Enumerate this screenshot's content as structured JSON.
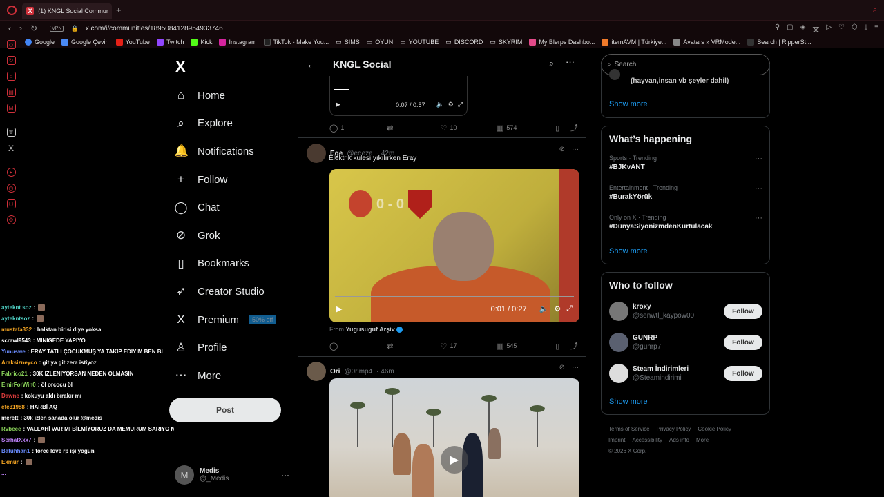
{
  "browser": {
    "tab_title": "(1) KNGL Social Communit",
    "url": "x.com/i/communities/1895084128954933746",
    "vpn": "VPN",
    "bookmarks": [
      "Google",
      "Google Çeviri",
      "YouTube",
      "Twitch",
      "Kick",
      "Instagram",
      "TikTok - Make You...",
      "SIMS",
      "OYUN",
      "YOUTUBE",
      "DISCORD",
      "SKYRIM",
      "My Blerps Dashbo...",
      "itemAVM | Türkiye...",
      "Avatars » VRMode...",
      "Search | RipperSt..."
    ]
  },
  "chat": [
    {
      "user": "ayteknt soz",
      "msg": ":",
      "color": "#4fd1c5"
    },
    {
      "user": "aytekntsoz",
      "msg": ":",
      "color": "#4fd1c5"
    },
    {
      "user": "mustafa332",
      "msg": ": halktan birisi diye yoksa",
      "color": "#f6a623"
    },
    {
      "user": "scrawl9543",
      "msg": ": MİNİGEDE YAPIYO",
      "color": "#ffffff"
    },
    {
      "user": "Yunuswe",
      "msg": ": ERAY TATLI ÇOCUKMUŞ YA TAKİP EDİYİM BEN Bİ",
      "color": "#6a8cff"
    },
    {
      "user": "Araksizneyco",
      "msg": ": git ya git zera istiyoz",
      "color": "#f6a623"
    },
    {
      "user": "Fabrico21",
      "msg": ": 30K İZLENİYORSAN NEDEN OLMASIN",
      "color": "#8bd45a"
    },
    {
      "user": "EmirForWin0",
      "msg": ": öl orcocu öl",
      "color": "#8bd45a"
    },
    {
      "user": "Dawne",
      "msg": ": kokuyu aldı bırakır mı",
      "color": "#e53e3e"
    },
    {
      "user": "efe31988",
      "msg": ": HARBİ AQ",
      "color": "#f6a623"
    },
    {
      "user": "merett",
      "msg": ": 30k izlen sanada olur @medis",
      "color": "#ffffff"
    },
    {
      "user": "Rvbeee",
      "msg": ": VALLAHİ VAR MI BİLMİYORUZ DA MEMURUM SARIYO MAŞALLAH",
      "color": "#8bd45a"
    },
    {
      "user": "SerhatXxx7",
      "msg": ":",
      "color": "#c084fc"
    },
    {
      "user": "Batuhhan1",
      "msg": ": force love rp işi yogun",
      "color": "#6a8cff"
    },
    {
      "user": "Exmur",
      "msg": ":",
      "color": "#f6a623"
    },
    {
      "user": "...",
      "msg": "",
      "color": "#c084fc"
    }
  ],
  "nav": {
    "items": [
      {
        "label": "Home",
        "icon": "⌂"
      },
      {
        "label": "Explore",
        "icon": "⌕"
      },
      {
        "label": "Notifications",
        "icon": "🔔"
      },
      {
        "label": "Follow",
        "icon": "+"
      },
      {
        "label": "Chat",
        "icon": "◯"
      },
      {
        "label": "Grok",
        "icon": "⊘"
      },
      {
        "label": "Bookmarks",
        "icon": "▯"
      },
      {
        "label": "Creator Studio",
        "icon": "➶"
      },
      {
        "label": "Premium",
        "icon": "X"
      },
      {
        "label": "Profile",
        "icon": "♙"
      },
      {
        "label": "More",
        "icon": "⋯"
      }
    ],
    "premium_badge": "50% off",
    "post_label": "Post",
    "account_initial": "M",
    "account_name": "Medis",
    "account_handle": "@_Medis"
  },
  "feed": {
    "title": "KNGL Social",
    "video_top": {
      "time": "0:07 / 0:57",
      "progress": 0.12
    },
    "actions_top": {
      "replies": "1",
      "reposts": "",
      "likes": "10",
      "views": "574"
    },
    "tweet1": {
      "name": "Ege",
      "handle": "@eqeza",
      "time": "· 42m",
      "text": "Elektrik kulesi yıkılırken Eray",
      "score": "0 - 0",
      "video_time": "0:01 / 0:27",
      "from_label": "From",
      "from_name": "Yugusuguf Arşiv",
      "likes": "17",
      "views": "545"
    },
    "tweet2": {
      "name": "Ori",
      "handle": "@0rimp4",
      "time": "· 46m"
    }
  },
  "right": {
    "search_placeholder": "Search",
    "community_snippet": "(hayvan,insan vb şeyler dahil)",
    "show_more": "Show more",
    "whats_happening": "What’s happening",
    "trends": [
      {
        "meta": "Sports · Trending",
        "tag": "#BJKvANT"
      },
      {
        "meta": "Entertainment · Trending",
        "tag": "#BurakYörük"
      },
      {
        "meta": "Only on X · Trending",
        "tag": "#DünyaSiyonizmdenKurtulacak"
      }
    ],
    "who_to_follow": "Who to follow",
    "follow_label": "Follow",
    "suggestions": [
      {
        "name": "kroxy",
        "handle": "@senwtl_kaypow00",
        "color": "#888"
      },
      {
        "name": "GUNRP",
        "handle": "@gunrp7",
        "color": "#667"
      },
      {
        "name": "Steam İndirimleri",
        "handle": "@Steamindirimi",
        "color": "#ccc"
      }
    ],
    "footer": [
      "Terms of Service",
      "Privacy Policy",
      "Cookie Policy",
      "Imprint",
      "Accessibility",
      "Ads info",
      "More ···",
      "© 2026 X Corp."
    ]
  }
}
